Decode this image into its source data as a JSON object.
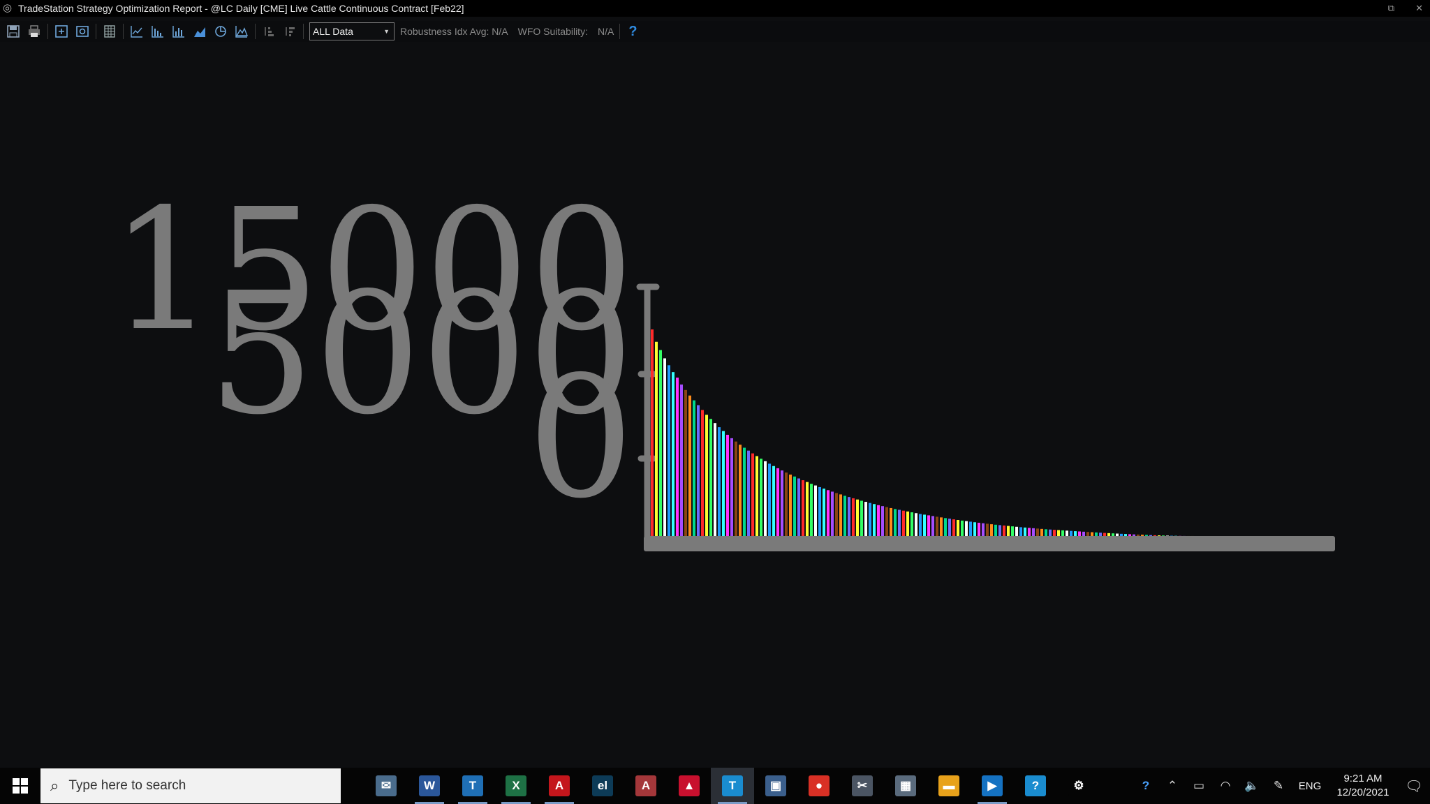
{
  "window": {
    "title": "TradeStation Strategy Optimization Report - @LC Daily [CME] Live Cattle Continuous Contract [Feb22]",
    "controls": [
      "restore",
      "close"
    ]
  },
  "toolbar": {
    "icons": [
      "save-icon",
      "print-icon",
      "fit-icon",
      "camera-icon",
      "grid-icon",
      "line-chart-icon",
      "bar-chart-icon",
      "histogram-icon",
      "area-chart-icon",
      "pie-chart-icon",
      "mountain-chart-icon",
      "sort-asc-icon",
      "sort-desc-icon"
    ],
    "data_select": "ALL Data",
    "robustness_label": "Robustness Idx Avg: N/A",
    "wfo_label": "WFO Suitability:",
    "wfo_value": "N/A",
    "help": "?"
  },
  "chart_data": {
    "type": "bar",
    "y_tick_labels": [
      "15000",
      "5000",
      "0"
    ],
    "bar_count": 130,
    "values": [
      15000,
      14100,
      13500,
      12900,
      12400,
      11900,
      11500,
      11000,
      10600,
      10200,
      9850,
      9500,
      9150,
      8800,
      8500,
      8200,
      7900,
      7620,
      7350,
      7100,
      6860,
      6630,
      6410,
      6200,
      6000,
      5800,
      5610,
      5430,
      5250,
      5080,
      4920,
      4760,
      4610,
      4460,
      4320,
      4180,
      4050,
      3920,
      3790,
      3670,
      3550,
      3440,
      3330,
      3220,
      3120,
      3020,
      2920,
      2830,
      2740,
      2650,
      2560,
      2480,
      2400,
      2320,
      2240,
      2170,
      2100,
      2030,
      1960,
      1900,
      1840,
      1780,
      1720,
      1660,
      1600,
      1550,
      1500,
      1450,
      1400,
      1350,
      1300,
      1255,
      1210,
      1165,
      1120,
      1080,
      1040,
      1000,
      960,
      925,
      890,
      855,
      820,
      790,
      760,
      730,
      700,
      670,
      640,
      615,
      590,
      565,
      540,
      515,
      490,
      470,
      450,
      430,
      410,
      390,
      370,
      350,
      330,
      312,
      294,
      276,
      258,
      240,
      224,
      208,
      192,
      176,
      160,
      146,
      132,
      118,
      104,
      92,
      80,
      68,
      56,
      46,
      36,
      28,
      20,
      14,
      8,
      4,
      2,
      1
    ],
    "colors": [
      "#ff2a2a",
      "#ffff33",
      "#33ff66",
      "#ffffff",
      "#1f9bff",
      "#33ffff",
      "#ff33ff",
      "#a64dff",
      "#8b4513",
      "#ff8c1a",
      "#00d98c",
      "#6b6bff"
    ],
    "ylim": [
      0,
      15000
    ]
  },
  "taskbar": {
    "search_placeholder": "Type here to search",
    "apps": [
      {
        "name": "mail-app-icon",
        "glyph": "✉",
        "bg": "#4a6c8c",
        "running": false
      },
      {
        "name": "word-icon",
        "glyph": "W",
        "bg": "#2b579a",
        "running": true
      },
      {
        "name": "tradestation-desktop-icon",
        "glyph": "T",
        "bg": "#1f6fb5",
        "running": true
      },
      {
        "name": "excel-icon",
        "glyph": "X",
        "bg": "#1e7145",
        "running": true
      },
      {
        "name": "acrobat-icon",
        "glyph": "A",
        "bg": "#c4161c",
        "running": true
      },
      {
        "name": "easylanguage-icon",
        "glyph": "el",
        "bg": "#0d3b57",
        "running": false
      },
      {
        "name": "access-icon",
        "glyph": "A",
        "bg": "#a4373a",
        "running": false
      },
      {
        "name": "pdf-reader-icon",
        "glyph": "▲",
        "bg": "#c8102e",
        "running": false
      },
      {
        "name": "tradestation-icon",
        "glyph": "T",
        "bg": "#1a8ccf",
        "running": true
      },
      {
        "name": "network-app-icon",
        "glyph": "▣",
        "bg": "#3b5f8c",
        "running": false
      },
      {
        "name": "chrome-icon",
        "glyph": "●",
        "bg": "#d93025",
        "running": false
      },
      {
        "name": "snipping-tool-icon",
        "glyph": "✂",
        "bg": "#4b5563",
        "running": false
      },
      {
        "name": "calculator-icon",
        "glyph": "▦",
        "bg": "#5a6b7d",
        "running": false
      },
      {
        "name": "file-explorer-icon",
        "glyph": "▬",
        "bg": "#e8a21b",
        "running": false
      },
      {
        "name": "media-player-icon",
        "glyph": "▶",
        "bg": "#1572c2",
        "running": true
      },
      {
        "name": "help-app-icon",
        "glyph": "?",
        "bg": "#1a8ccf",
        "running": false
      },
      {
        "name": "settings-icon",
        "glyph": "⚙",
        "bg": "#050505",
        "running": false
      }
    ],
    "tray": {
      "language": "ENG",
      "time": "9:21 AM",
      "date": "12/20/2021"
    }
  }
}
